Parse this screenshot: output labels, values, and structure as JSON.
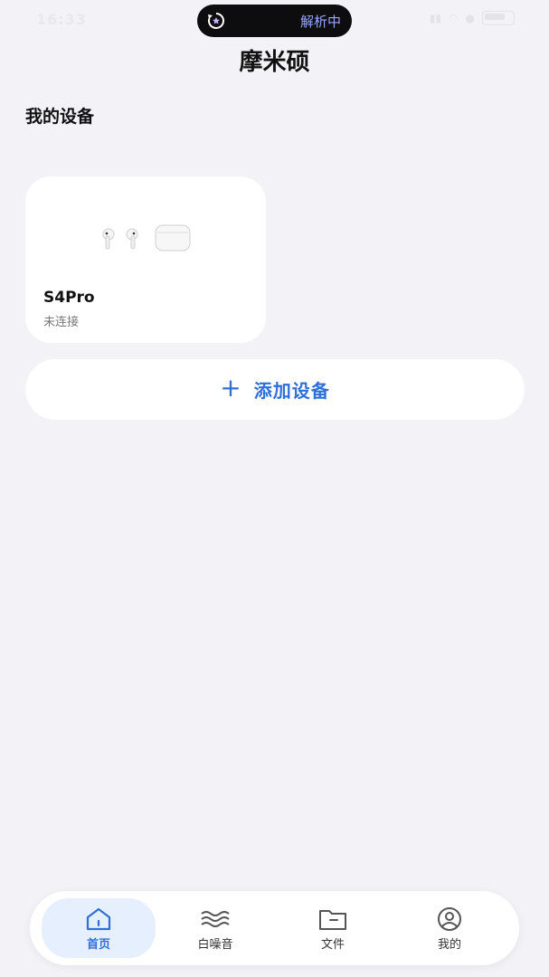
{
  "status_bar": {
    "time": "16:33",
    "island_text": "解析中"
  },
  "header": {
    "title": "摩米硕"
  },
  "section": {
    "title": "我的设备"
  },
  "device": {
    "name": "S4Pro",
    "status": "未连接"
  },
  "add_device": {
    "icon": "+",
    "label": "添加设备"
  },
  "tabs": [
    {
      "label": "首页",
      "icon": "home-icon",
      "active": true
    },
    {
      "label": "白噪音",
      "icon": "waves-icon",
      "active": false
    },
    {
      "label": "文件",
      "icon": "folder-icon",
      "active": false
    },
    {
      "label": "我的",
      "icon": "profile-icon",
      "active": false
    }
  ],
  "colors": {
    "accent": "#2f6fd6",
    "background": "#f2f2f7",
    "card": "#ffffff"
  }
}
